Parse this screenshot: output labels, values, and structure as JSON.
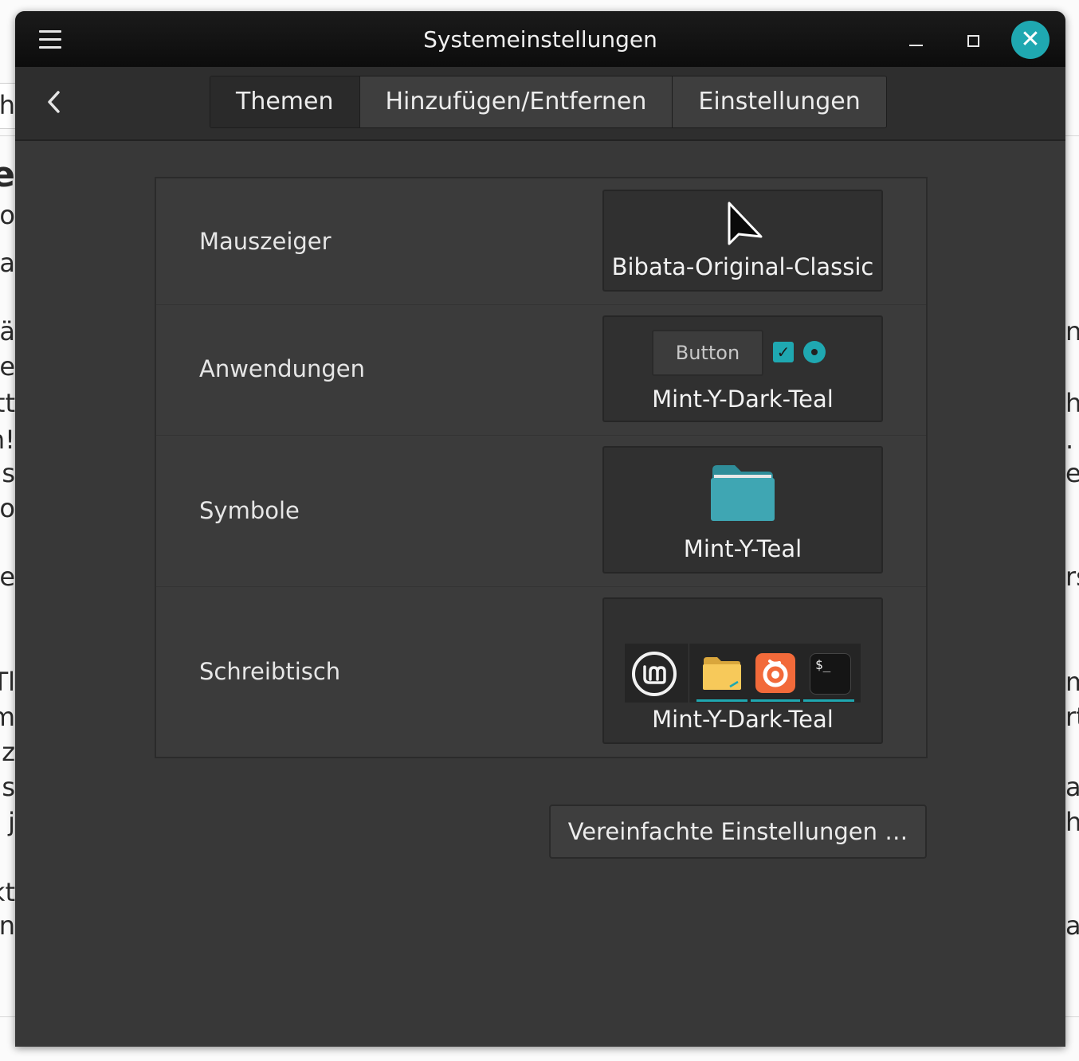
{
  "window": {
    "title": "Systemeinstellungen",
    "close_symbol": "✕",
    "back_symbol": "‹"
  },
  "tabs": [
    {
      "label": "Themen",
      "active": true
    },
    {
      "label": "Hinzufügen/Entfernen",
      "active": false
    },
    {
      "label": "Einstellungen",
      "active": false
    }
  ],
  "theme_rows": [
    {
      "label": "Mauszeiger",
      "value": "Bibata-Original-Classic",
      "preview_icon": "cursor-arrow-icon"
    },
    {
      "label": "Anwendungen",
      "value": "Mint-Y-Dark-Teal",
      "preview": {
        "button_label": "Button",
        "checkbox_checked": true,
        "radio_selected": true
      }
    },
    {
      "label": "Symbole",
      "value": "Mint-Y-Teal",
      "preview_icon": "folder-icon"
    },
    {
      "label": "Schreibtisch",
      "value": "Mint-Y-Dark-Teal",
      "preview": {
        "terminal_prompt": "$_"
      }
    }
  ],
  "simplified_settings_button": "Vereinfachte Einstellungen …",
  "colors": {
    "accent": "#1fa8b1",
    "window_bg": "#383838",
    "titlebar_bg": "#111111",
    "folder_teal": "#3fa6b3",
    "folder_yellow": "#f7c95a",
    "firefox_orange": "#f26a3a"
  },
  "background_fragments": {
    "left": [
      "ch",
      "e",
      "lo",
      "a",
      "ä",
      "e",
      "tt",
      "n!",
      "is",
      "o",
      "ie",
      "Tl",
      "m",
      "nz",
      "s",
      "r j",
      "kt",
      "n"
    ],
    "right": [
      "n",
      "h",
      ".",
      "e",
      "rs",
      "m",
      "rt",
      "a",
      "h",
      "ab"
    ]
  }
}
